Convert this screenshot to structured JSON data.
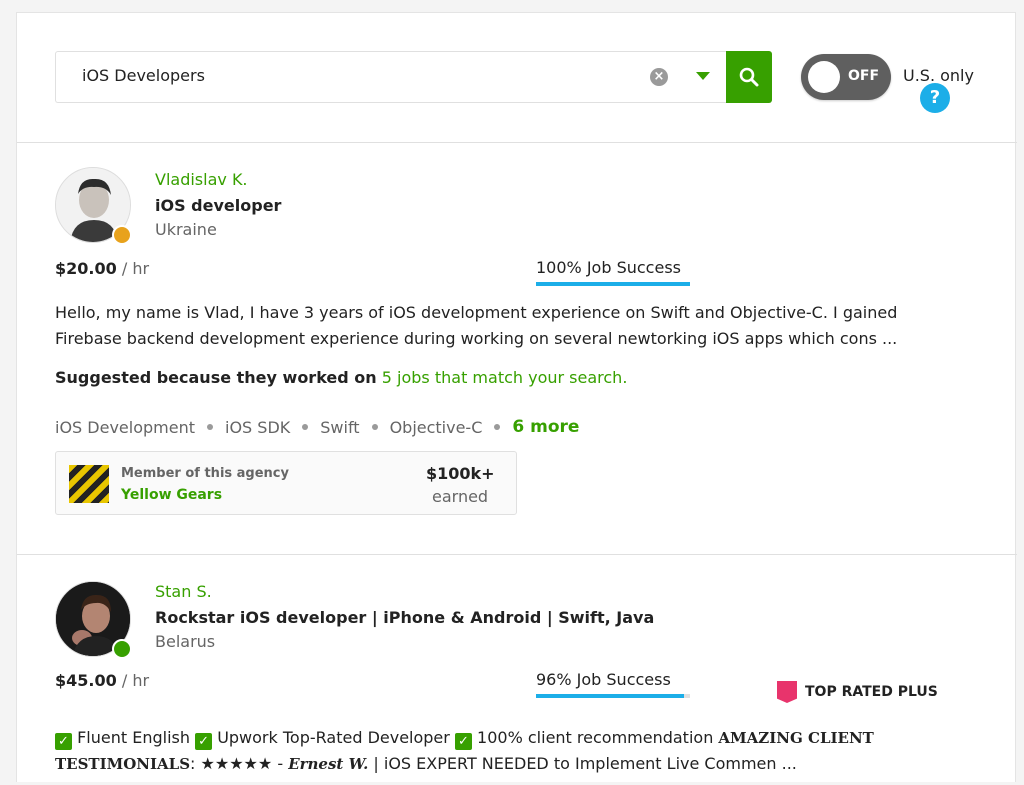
{
  "search": {
    "value": "iOS Developers",
    "clear_glyph": "×"
  },
  "filter": {
    "toggle_label": "OFF",
    "us_only": "U.S. only",
    "help_glyph": "?"
  },
  "freelancers": [
    {
      "name": "Vladislav K.",
      "title": "iOS developer",
      "country": "Ukraine",
      "status_color": "#e8a21c",
      "rate": "$20.00",
      "rate_unit": "/ hr",
      "job_success": "100% Job Success",
      "job_success_pct": 100,
      "description_line1": "Hello, my name is Vlad, I have 3 years of iOS development experience on Swift and Objective-C. I gained",
      "description_line2": "Firebase backend development experience during working on several newtorking iOS apps which cons ...",
      "suggested_prefix": "Suggested because they worked on",
      "suggested_link": "5 jobs that match your search.",
      "skills": [
        "iOS Development",
        "iOS SDK",
        "Swift",
        "Objective-C"
      ],
      "more_skills": "6 more",
      "agency": {
        "member_label": "Member of this agency",
        "name": "Yellow Gears",
        "earned_value": "$100k+",
        "earned_label": "earned"
      }
    },
    {
      "name": "Stan S.",
      "title": "Rockstar iOS developer | iPhone & Android | Swift, Java",
      "country": "Belarus",
      "status_color": "#37a000",
      "rate": "$45.00",
      "rate_unit": "/ hr",
      "job_success": "96% Job Success",
      "job_success_pct": 96,
      "badge": "TOP RATED PLUS",
      "desc_check": "✓",
      "desc_a": "Fluent English",
      "desc_b": "Upwork Top-Rated Developer",
      "desc_c": "100% client recommendation",
      "desc_d": "AMAZING CLIENT",
      "desc_e": "TESTIMONIALS",
      "desc_f": ": ★★★★★ -",
      "desc_g": "Ernest W.",
      "desc_h": "| iOS EXPERT NEEDED to Implement Live Commen ..."
    }
  ],
  "colors": {
    "accent": "#37a000",
    "progress": "#1caee8",
    "top_rated": "#e8346c"
  }
}
